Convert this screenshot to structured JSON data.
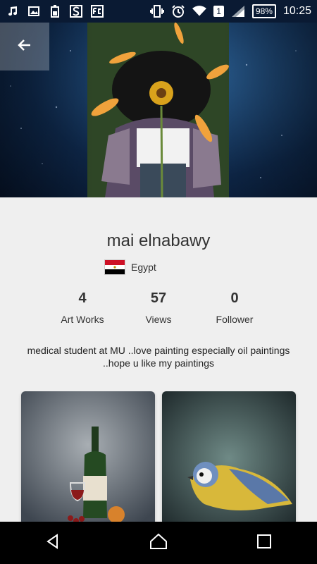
{
  "status_bar": {
    "time": "10:25",
    "battery": "98%",
    "sim_badge": "1",
    "icons": [
      "music-note-icon",
      "image-icon",
      "battery-saver-icon",
      "s-app-icon",
      "fc-app-icon",
      "vibrate-icon",
      "alarm-icon",
      "wifi-icon",
      "signal-icon"
    ]
  },
  "profile": {
    "name": "mai elnabawy",
    "country": "Egypt",
    "stats": [
      {
        "value": "4",
        "label": "Art Works"
      },
      {
        "value": "57",
        "label": "Views"
      },
      {
        "value": "0",
        "label": "Follower"
      }
    ],
    "bio": "medical student at MU ..love painting especially oil paintings ..hope u like my paintings"
  },
  "colors": {
    "status_bar_bg": "#0a1a33",
    "page_bg": "#efefef",
    "text": "#333333"
  }
}
